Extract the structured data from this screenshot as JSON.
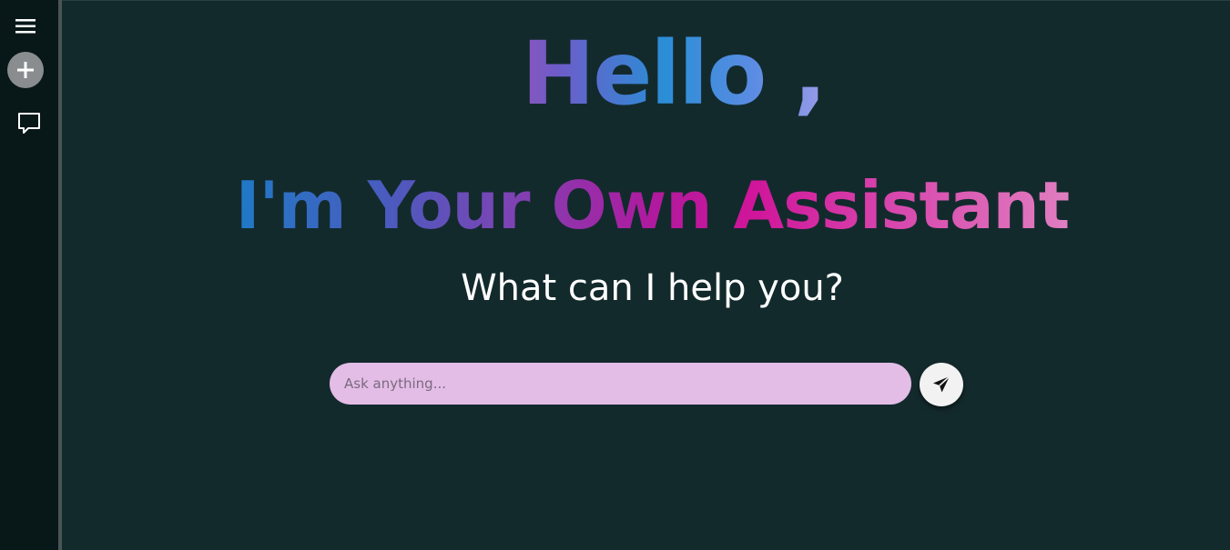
{
  "sidebar": {
    "menu_icon": "hamburger-menu-icon",
    "new_chat_icon": "plus-icon",
    "chat_icon": "chat-bubble-icon"
  },
  "main": {
    "greeting": "Hello ,",
    "headline": "I'm Your Own Assistant",
    "subtitle": "What can I help you?",
    "search": {
      "placeholder": "Ask anything...",
      "value": ""
    },
    "send_icon": "send-icon"
  },
  "colors": {
    "background": "#132a2d",
    "sidebar": "#081718",
    "input": "#e3bde6",
    "send_button": "#f2f2f2"
  }
}
